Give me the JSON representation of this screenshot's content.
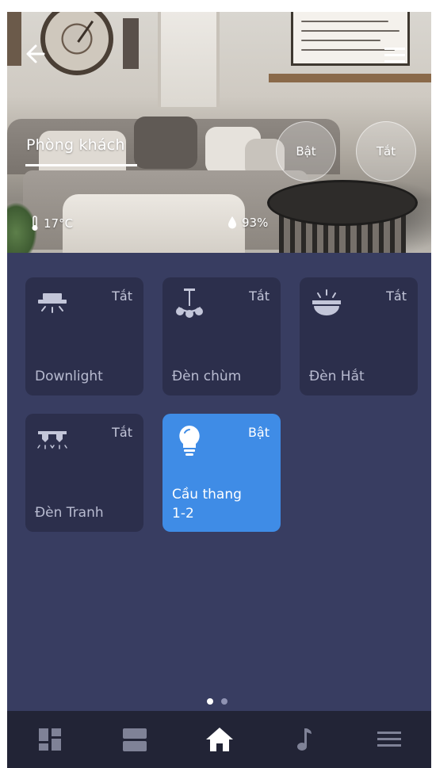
{
  "room": {
    "name": "Phòng khách"
  },
  "quick_actions": {
    "on_label": "Bật",
    "off_label": "Tắt"
  },
  "stats": {
    "temperature": "17°C",
    "humidity": "93%"
  },
  "devices": [
    {
      "name": "Downlight",
      "status": "Tắt",
      "icon": "downlight-icon",
      "on": false
    },
    {
      "name": "Đèn chùm",
      "status": "Tắt",
      "icon": "chandelier-icon",
      "on": false
    },
    {
      "name": "Đèn Hắt",
      "status": "Tắt",
      "icon": "indirect-light-icon",
      "on": false
    },
    {
      "name": "Đèn Tranh",
      "status": "Tắt",
      "icon": "picture-light-icon",
      "on": false
    },
    {
      "name": "Cầu thang 1-2",
      "status": "Bật",
      "icon": "bulb-icon",
      "on": true
    }
  ],
  "pager": {
    "pages": 2,
    "current": 1
  },
  "nav": [
    {
      "icon": "dashboard-icon"
    },
    {
      "icon": "rooms-icon"
    },
    {
      "icon": "home-icon",
      "active": true
    },
    {
      "icon": "music-icon"
    },
    {
      "icon": "menu-icon"
    }
  ],
  "colors": {
    "background": "#383d61",
    "card_off": "#2c2f4c",
    "card_on": "#3f8ce6",
    "nav_bar": "#222436"
  }
}
